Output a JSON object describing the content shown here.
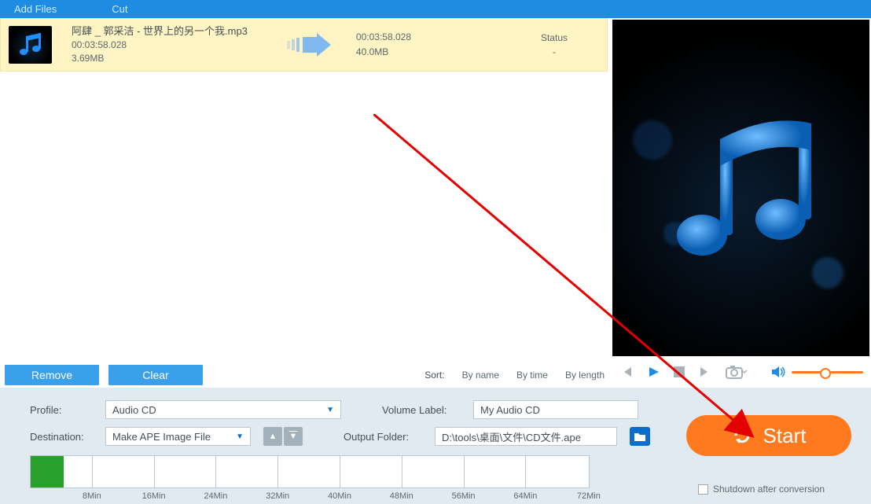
{
  "menu": {
    "add": "Add Files",
    "cut": "Cut"
  },
  "file": {
    "name": "阿肆 _ 郭采洁 - 世界上的另一个我.mp3",
    "duration": "00:03:58.028",
    "size": "3.69MB",
    "out_duration": "00:03:58.028",
    "out_size": "40.0MB",
    "status_label": "Status",
    "status_value": "-"
  },
  "controls": {
    "remove": "Remove",
    "clear": "Clear",
    "sort_label": "Sort:",
    "sort_name": "By name",
    "sort_time": "By time",
    "sort_length": "By length"
  },
  "settings": {
    "profile_label": "Profile:",
    "profile_value": "Audio CD",
    "dest_label": "Destination:",
    "dest_value": "Make APE Image File",
    "vol_label": "Volume Label:",
    "vol_value": "My Audio CD",
    "out_label": "Output Folder:",
    "out_value": "D:\\tools\\桌面\\文件\\CD文件.ape"
  },
  "ruler": {
    "ticks": [
      "8Min",
      "16Min",
      "24Min",
      "32Min",
      "40Min",
      "48Min",
      "56Min",
      "64Min",
      "72Min"
    ]
  },
  "start": {
    "label": "Start",
    "shutdown": "Shutdown after conversion"
  }
}
